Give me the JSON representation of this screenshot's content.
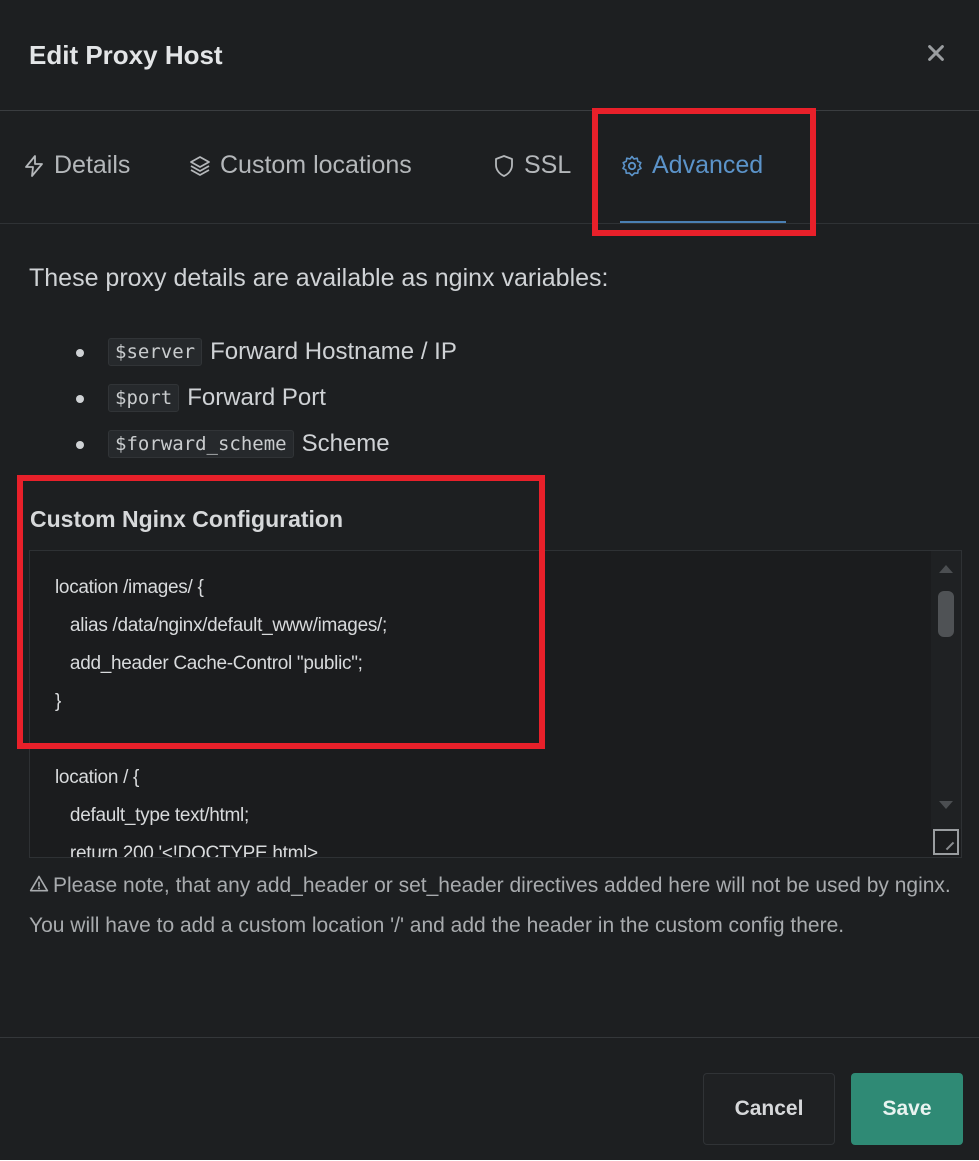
{
  "modal": {
    "title": "Edit Proxy Host",
    "close_icon": "close-icon"
  },
  "tabs": [
    {
      "label": "Details",
      "icon": "lightning-icon",
      "active": false
    },
    {
      "label": "Custom locations",
      "icon": "layers-icon",
      "active": false
    },
    {
      "label": "SSL",
      "icon": "shield-icon",
      "active": false
    },
    {
      "label": "Advanced",
      "icon": "gear-icon",
      "active": true
    }
  ],
  "advanced": {
    "intro": "These proxy details are available as nginx variables:",
    "variables": [
      {
        "code": "$server",
        "description": "Forward Hostname / IP"
      },
      {
        "code": "$port",
        "description": "Forward Port"
      },
      {
        "code": "$forward_scheme",
        "description": "Scheme"
      }
    ],
    "config_label": "Custom Nginx Configuration",
    "config_value": "location /images/ {\n   alias /data/nginx/default_www/images/;\n   add_header Cache-Control \"public\";\n}\n\nlocation / {\n   default_type text/html;\n   return 200 '<!DOCTYPE html>",
    "note": "Please note, that any add_header or set_header directives added here will not be used by nginx. You will have to add a custom location '/' and add the header in the custom config there."
  },
  "footer": {
    "cancel_label": "Cancel",
    "save_label": "Save"
  },
  "colors": {
    "background": "#1d1f21",
    "active_tab": "#5b93c9",
    "save_button": "#2f8a75",
    "annotation_highlight": "#e8202a"
  }
}
